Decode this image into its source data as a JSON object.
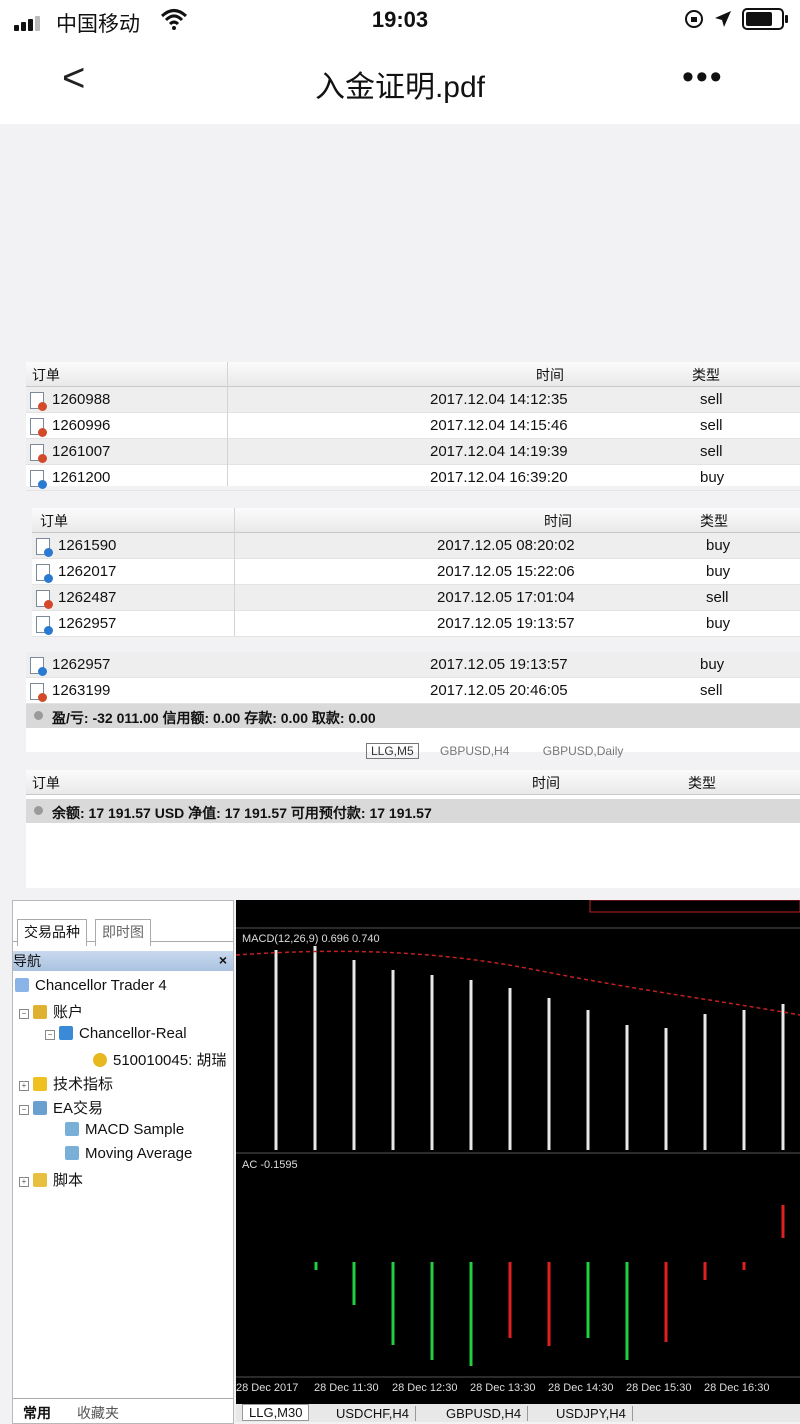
{
  "status": {
    "carrier": "中国移动",
    "time": "19:03"
  },
  "nav": {
    "title": "入金证明.pdf",
    "back": "<",
    "more": "•••"
  },
  "table_header": {
    "order": "订单",
    "time": "时间",
    "type": "类型"
  },
  "block1": [
    {
      "order": "1260988",
      "time": "2017.12.04 14:12:35",
      "type": "sell"
    },
    {
      "order": "1260996",
      "time": "2017.12.04 14:15:46",
      "type": "sell"
    },
    {
      "order": "1261007",
      "time": "2017.12.04 14:19:39",
      "type": "sell"
    },
    {
      "order": "1261200",
      "time": "2017.12.04 16:39:20",
      "type": "buy"
    }
  ],
  "block2": [
    {
      "order": "1261590",
      "time": "2017.12.05 08:20:02",
      "type": "buy"
    },
    {
      "order": "1262017",
      "time": "2017.12.05 15:22:06",
      "type": "buy"
    },
    {
      "order": "1262487",
      "time": "2017.12.05 17:01:04",
      "type": "sell"
    },
    {
      "order": "1262957",
      "time": "2017.12.05 19:13:57",
      "type": "buy"
    }
  ],
  "block3": [
    {
      "order": "1262957",
      "time": "2017.12.05 19:13:57",
      "type": "buy"
    },
    {
      "order": "1263199",
      "time": "2017.12.05 20:46:05",
      "type": "sell"
    }
  ],
  "summary1": "盈/亏: -32 011.00  信用额: 0.00  存款: 0.00  取款: 0.00",
  "summary2": "余额: 17 191.57 USD  净值: 17 191.57  可用预付款: 17 191.57",
  "tabs_strip": [
    "LLG,M5",
    "GBPUSD,H4",
    "GBPUSD,Daily"
  ],
  "left": {
    "tabs": [
      "交易品种",
      "即时图"
    ],
    "nav_title": "导航",
    "close": "×",
    "tree": [
      "Chancellor Trader 4",
      "账户",
      "Chancellor-Real",
      "510010045: 胡瑞",
      "技术指标",
      "EA交易",
      "MACD Sample",
      "Moving Average",
      "脚本"
    ],
    "bottom_tabs": [
      "常用",
      "收藏夹"
    ]
  },
  "chart": {
    "macd_label": "MACD(12,26,9) 0.696 0.740",
    "ac_label": "AC -0.1595",
    "xticks": [
      "28 Dec 2017",
      "28 Dec 11:30",
      "28 Dec 12:30",
      "28 Dec 13:30",
      "28 Dec 14:30",
      "28 Dec 15:30",
      "28 Dec 16:30"
    ],
    "tabs": [
      "LLG,M30",
      "USDCHF,H4",
      "GBPUSD,H4",
      "USDJPY,H4"
    ]
  }
}
